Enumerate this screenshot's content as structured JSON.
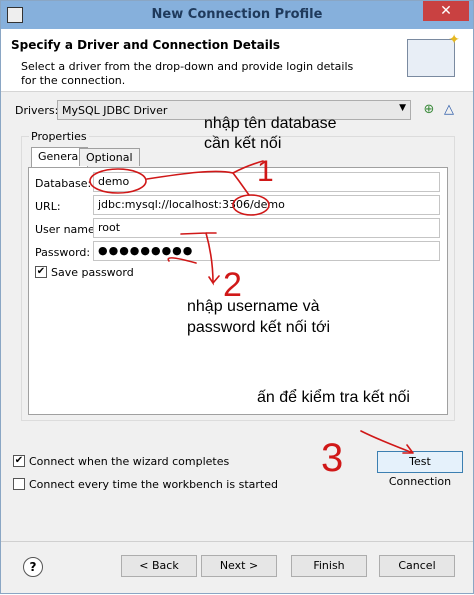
{
  "window": {
    "title": "New Connection Profile",
    "close_glyph": "✕"
  },
  "header": {
    "title": "Specify a Driver and Connection Details",
    "description": "Select a driver from the drop-down and provide login details for the connection."
  },
  "drivers": {
    "label": "Drivers:",
    "value": "MySQL JDBC Driver"
  },
  "properties": {
    "group_label": "Properties",
    "tabs": [
      "General",
      "Optional"
    ],
    "database": {
      "label": "Database:",
      "value": "demo"
    },
    "url": {
      "label": "URL:",
      "value": "jdbc:mysql://localhost:3306/demo"
    },
    "username": {
      "label": "User name:",
      "value": "root"
    },
    "password": {
      "label": "Password:",
      "value": "●●●●●●●●●"
    },
    "save_password": {
      "label": "Save password",
      "checked": true
    }
  },
  "options": {
    "connect_when_complete": {
      "label": "Connect when the wizard completes",
      "checked": true
    },
    "connect_every_time": {
      "label": "Connect every time the workbench is started",
      "checked": false
    }
  },
  "buttons": {
    "test_connection": "Test Connection",
    "back": "< Back",
    "next": "Next >",
    "finish": "Finish",
    "cancel": "Cancel",
    "help": "?"
  },
  "annotations": {
    "note1_line1": "nhập tên database",
    "note1_line2": "cần kết nối",
    "note2_line1": "nhập username và",
    "note2_line2": "password kết nối tới",
    "note3": "ấn để kiểm tra kết nối",
    "num1": "1",
    "num2": "2",
    "num3": "3"
  }
}
